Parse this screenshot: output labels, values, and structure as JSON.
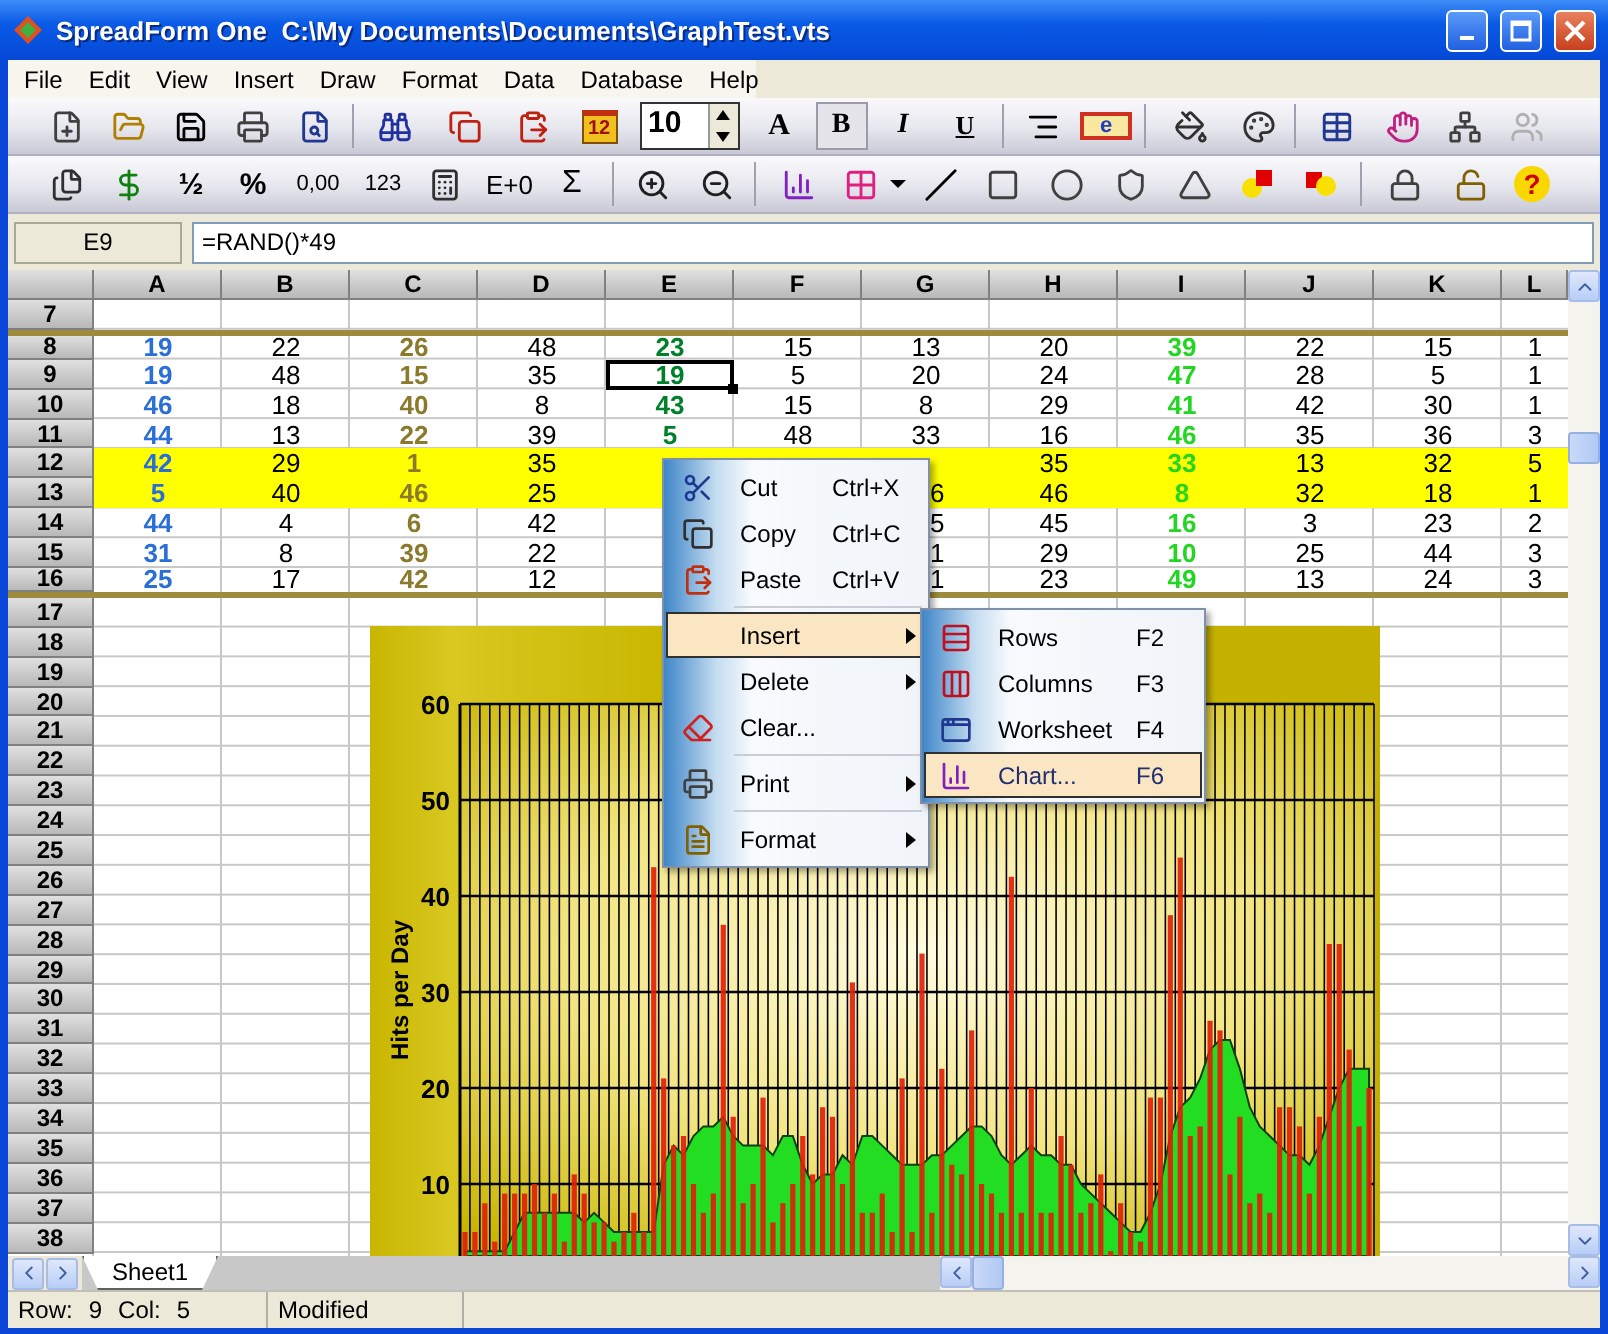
{
  "window": {
    "title": "SpreadForm One  C:\\My Documents\\Documents\\GraphTest.vts"
  },
  "menu": [
    "File",
    "Edit",
    "View",
    "Insert",
    "Draw",
    "Format",
    "Data",
    "Database",
    "Help"
  ],
  "toolbar_1": {
    "calendar": "12",
    "font_size": "10",
    "field_code": "e",
    "style_buttons": [
      {
        "label": "A",
        "pressed": false
      },
      {
        "label": "B",
        "pressed": true
      },
      {
        "label": "I",
        "pressed": false
      },
      {
        "label": "U",
        "pressed": false
      }
    ]
  },
  "toolbar_2": {
    "format_buttons": [
      "½",
      "%",
      "0,00",
      "123"
    ],
    "exponent": "E+0",
    "sum": "Σ",
    "help": "?"
  },
  "formula_bar": {
    "cell": "E9",
    "formula": "=RAND()*49"
  },
  "columns": [
    {
      "label": "A",
      "color": "#2a6fd6",
      "bold": true
    },
    {
      "label": "B",
      "color": "#000000",
      "bold": false
    },
    {
      "label": "C",
      "color": "#8c7a2c",
      "bold": true
    },
    {
      "label": "D",
      "color": "#000000",
      "bold": false
    },
    {
      "label": "E",
      "color": "#00802a",
      "bold": true
    },
    {
      "label": "F",
      "color": "#000000",
      "bold": false
    },
    {
      "label": "G",
      "color": "#000000",
      "bold": false
    },
    {
      "label": "H",
      "color": "#000000",
      "bold": false
    },
    {
      "label": "I",
      "color": "#22d622",
      "bold": true
    },
    {
      "label": "J",
      "color": "#000000",
      "bold": false
    },
    {
      "label": "K",
      "color": "#000000",
      "bold": false
    },
    {
      "label": "L",
      "color": "#000000",
      "bold": false
    }
  ],
  "rows": [
    {
      "label": "7",
      "highlighted": false,
      "rule_above": false,
      "rule_below": false
    },
    {
      "label": "8",
      "highlighted": false,
      "rule_above": true,
      "rule_below": false,
      "cells": [
        "19",
        "22",
        "26",
        "48",
        "23",
        "15",
        "13",
        "20",
        "39",
        "22",
        "15",
        "1"
      ]
    },
    {
      "label": "9",
      "highlighted": false,
      "rule_above": false,
      "rule_below": false,
      "cells": [
        "19",
        "48",
        "15",
        "35",
        {
          "text": "19",
          "selected": true
        },
        "5",
        "20",
        "24",
        "47",
        "28",
        "5",
        "1"
      ]
    },
    {
      "label": "10",
      "highlighted": false,
      "rule_above": false,
      "rule_below": false,
      "cells": [
        "46",
        "18",
        "40",
        "8",
        "43",
        "15",
        "8",
        "29",
        "41",
        "42",
        "30",
        "1"
      ]
    },
    {
      "label": "11",
      "highlighted": false,
      "rule_above": false,
      "rule_below": false,
      "cells": [
        "44",
        "13",
        "22",
        "39",
        "5",
        "48",
        "33",
        "16",
        "46",
        "35",
        "36",
        "3"
      ]
    },
    {
      "label": "12",
      "highlighted": true,
      "rule_above": false,
      "rule_below": false,
      "cells": [
        "42",
        "29",
        "1",
        "35",
        null,
        null,
        null,
        "35",
        "33",
        "13",
        "32",
        "5"
      ]
    },
    {
      "label": "13",
      "highlighted": true,
      "rule_above": false,
      "rule_below": false,
      "cells": [
        "5",
        "40",
        "46",
        "25",
        null,
        null,
        {
          "text": "6",
          "partial": true
        },
        "46",
        "8",
        "32",
        "18",
        "1"
      ]
    },
    {
      "label": "14",
      "highlighted": false,
      "rule_above": false,
      "rule_below": false,
      "cells": [
        "44",
        "4",
        "6",
        "42",
        null,
        null,
        {
          "text": "5",
          "partial": true
        },
        "45",
        "16",
        "3",
        "23",
        "2"
      ]
    },
    {
      "label": "15",
      "highlighted": false,
      "rule_above": false,
      "rule_below": false,
      "cells": [
        "31",
        "8",
        "39",
        "22",
        null,
        null,
        {
          "text": "1",
          "partial": true
        },
        "29",
        "10",
        "25",
        "44",
        "3"
      ]
    },
    {
      "label": "16",
      "highlighted": false,
      "rule_above": false,
      "rule_below": true,
      "cells": [
        "25",
        "17",
        "42",
        "12",
        null,
        null,
        {
          "text": "1",
          "partial": true
        },
        "23",
        "49",
        "13",
        "24",
        "3"
      ]
    },
    {
      "label": "17",
      "highlighted": false,
      "rule_above": false,
      "rule_below": false
    },
    {
      "label": "18",
      "highlighted": false,
      "rule_above": false,
      "rule_below": false
    },
    {
      "label": "19",
      "highlighted": false,
      "rule_above": false,
      "rule_below": false
    },
    {
      "label": "20",
      "highlighted": false,
      "rule_above": false,
      "rule_below": false
    },
    {
      "label": "21",
      "highlighted": false,
      "rule_above": false,
      "rule_below": false
    },
    {
      "label": "22",
      "highlighted": false,
      "rule_above": false,
      "rule_below": false
    },
    {
      "label": "23",
      "highlighted": false,
      "rule_above": false,
      "rule_below": false
    },
    {
      "label": "24",
      "highlighted": false,
      "rule_above": false,
      "rule_below": false
    },
    {
      "label": "25",
      "highlighted": false,
      "rule_above": false,
      "rule_below": false
    },
    {
      "label": "26",
      "highlighted": false,
      "rule_above": false,
      "rule_below": false
    },
    {
      "label": "27",
      "highlighted": false,
      "rule_above": false,
      "rule_below": false
    },
    {
      "label": "28",
      "highlighted": false,
      "rule_above": false,
      "rule_below": false
    },
    {
      "label": "29",
      "highlighted": false,
      "rule_above": false,
      "rule_below": false
    },
    {
      "label": "30",
      "highlighted": false,
      "rule_above": false,
      "rule_below": false
    },
    {
      "label": "31",
      "highlighted": false,
      "rule_above": false,
      "rule_below": false
    },
    {
      "label": "32",
      "highlighted": false,
      "rule_above": false,
      "rule_below": false
    },
    {
      "label": "33",
      "highlighted": false,
      "rule_above": false,
      "rule_below": false
    },
    {
      "label": "34",
      "highlighted": false,
      "rule_above": false,
      "rule_below": false
    },
    {
      "label": "35",
      "highlighted": false,
      "rule_above": false,
      "rule_below": false
    },
    {
      "label": "36",
      "highlighted": false,
      "rule_above": false,
      "rule_below": false
    },
    {
      "label": "37",
      "highlighted": false,
      "rule_above": false,
      "rule_below": false
    },
    {
      "label": "38",
      "highlighted": false,
      "rule_above": false,
      "rule_below": false
    }
  ],
  "chart": {
    "chart_data": {
      "type": "bar",
      "ylabel": "Hits per Day",
      "grid": true,
      "ylim": [
        2.5,
        60
      ],
      "yticks": [
        10,
        20,
        30,
        40,
        50,
        60
      ],
      "series": [
        {
          "type": "bar",
          "color": "#e0200c",
          "values": [
            5,
            5,
            8,
            4,
            9,
            9,
            9,
            10,
            7,
            9,
            4,
            11,
            9,
            6,
            6,
            4,
            5,
            7,
            5,
            43,
            21,
            14,
            15,
            10,
            7,
            9,
            37,
            17,
            8,
            10,
            19,
            6,
            8,
            10,
            15,
            11,
            18,
            17,
            10,
            31,
            7,
            7,
            9,
            5,
            21,
            5,
            34,
            7,
            22,
            12,
            11,
            26,
            10,
            9,
            7,
            42,
            7,
            20,
            7,
            7,
            15,
            12,
            7,
            8,
            11,
            3,
            8,
            5,
            4,
            19,
            19,
            38,
            44,
            15,
            16,
            27,
            26,
            11,
            17,
            8,
            9,
            7,
            18,
            18,
            16,
            9,
            17,
            35,
            35,
            24,
            16,
            20
          ]
        },
        {
          "type": "area",
          "color": "#22dd22",
          "values": [
            3,
            3,
            3,
            3,
            3,
            5,
            7,
            7,
            7,
            7,
            7,
            7,
            6,
            7,
            6,
            5,
            5,
            5,
            5,
            5,
            12,
            14,
            13,
            15,
            16,
            16,
            17,
            15,
            14,
            14,
            14,
            13,
            15,
            15,
            12,
            10,
            11,
            11,
            13,
            12,
            15,
            15,
            14,
            13,
            12,
            12,
            12,
            13,
            13,
            14,
            15,
            16,
            16,
            15,
            13,
            12,
            13,
            14,
            13,
            13,
            12,
            12,
            10,
            9,
            8,
            7,
            6,
            5,
            5,
            7,
            10,
            15,
            18,
            19,
            21,
            24,
            25,
            25,
            22,
            18,
            16,
            15,
            14,
            13,
            13,
            12,
            14,
            17,
            20,
            22,
            22,
            22
          ]
        }
      ]
    }
  },
  "context_menu": [
    {
      "kind": "item",
      "label": "Cut",
      "shortcut": "Ctrl+X",
      "submenu": false,
      "selected": false
    },
    {
      "kind": "item",
      "label": "Copy",
      "shortcut": "Ctrl+C",
      "submenu": false,
      "selected": false
    },
    {
      "kind": "item",
      "label": "Paste",
      "shortcut": "Ctrl+V",
      "submenu": false,
      "selected": false
    },
    {
      "kind": "separator"
    },
    {
      "kind": "item",
      "label": "Insert",
      "submenu": true,
      "selected": true
    },
    {
      "kind": "item",
      "label": "Delete",
      "submenu": true,
      "selected": false
    },
    {
      "kind": "item",
      "label": "Clear...",
      "submenu": false,
      "selected": false
    },
    {
      "kind": "separator"
    },
    {
      "kind": "item",
      "label": "Print",
      "submenu": true,
      "selected": false
    },
    {
      "kind": "separator"
    },
    {
      "kind": "item",
      "label": "Format",
      "submenu": true,
      "selected": false
    }
  ],
  "submenu": [
    {
      "label": "Rows",
      "shortcut": "F2",
      "selected": false
    },
    {
      "label": "Columns",
      "shortcut": "F3",
      "selected": false
    },
    {
      "label": "Worksheet",
      "shortcut": "F4",
      "selected": false
    },
    {
      "label": "Chart...",
      "shortcut": "F6",
      "selected": true
    }
  ],
  "sheet_tabs": [
    {
      "label": "Sheet1",
      "selected": true
    }
  ],
  "status_bar": {
    "row_label": "Row:",
    "row": "9",
    "col_label": "Col:",
    "col": "5",
    "state": "Modified"
  }
}
